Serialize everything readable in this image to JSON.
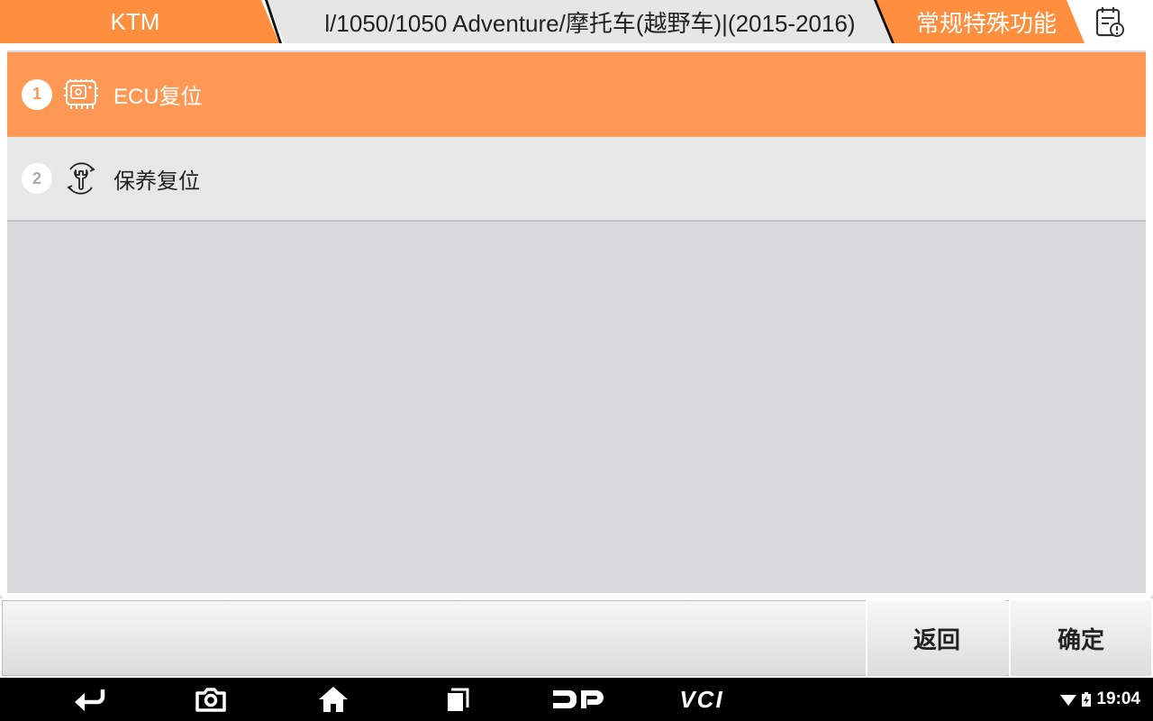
{
  "breadcrumb": {
    "make": "KTM",
    "model": "l/1050/1050 Adventure/摩托车(越野车)|(2015-2016)",
    "function": "常规特殊功能"
  },
  "icons": {
    "report": "report-clock-icon",
    "ecu": "ecu-module-icon",
    "service": "wrench-reset-icon"
  },
  "menu": {
    "items": [
      {
        "num": "1",
        "label": "ECU复位"
      },
      {
        "num": "2",
        "label": "保养复位"
      }
    ]
  },
  "buttons": {
    "back": "返回",
    "ok": "确定"
  },
  "navbar": {
    "vci_label": "VCI",
    "time": "19:04"
  },
  "colors": {
    "accent": "#ff8f3e",
    "selected_row": "#ff9755",
    "row": "#e6e7e7",
    "background": "#d7dadc"
  }
}
